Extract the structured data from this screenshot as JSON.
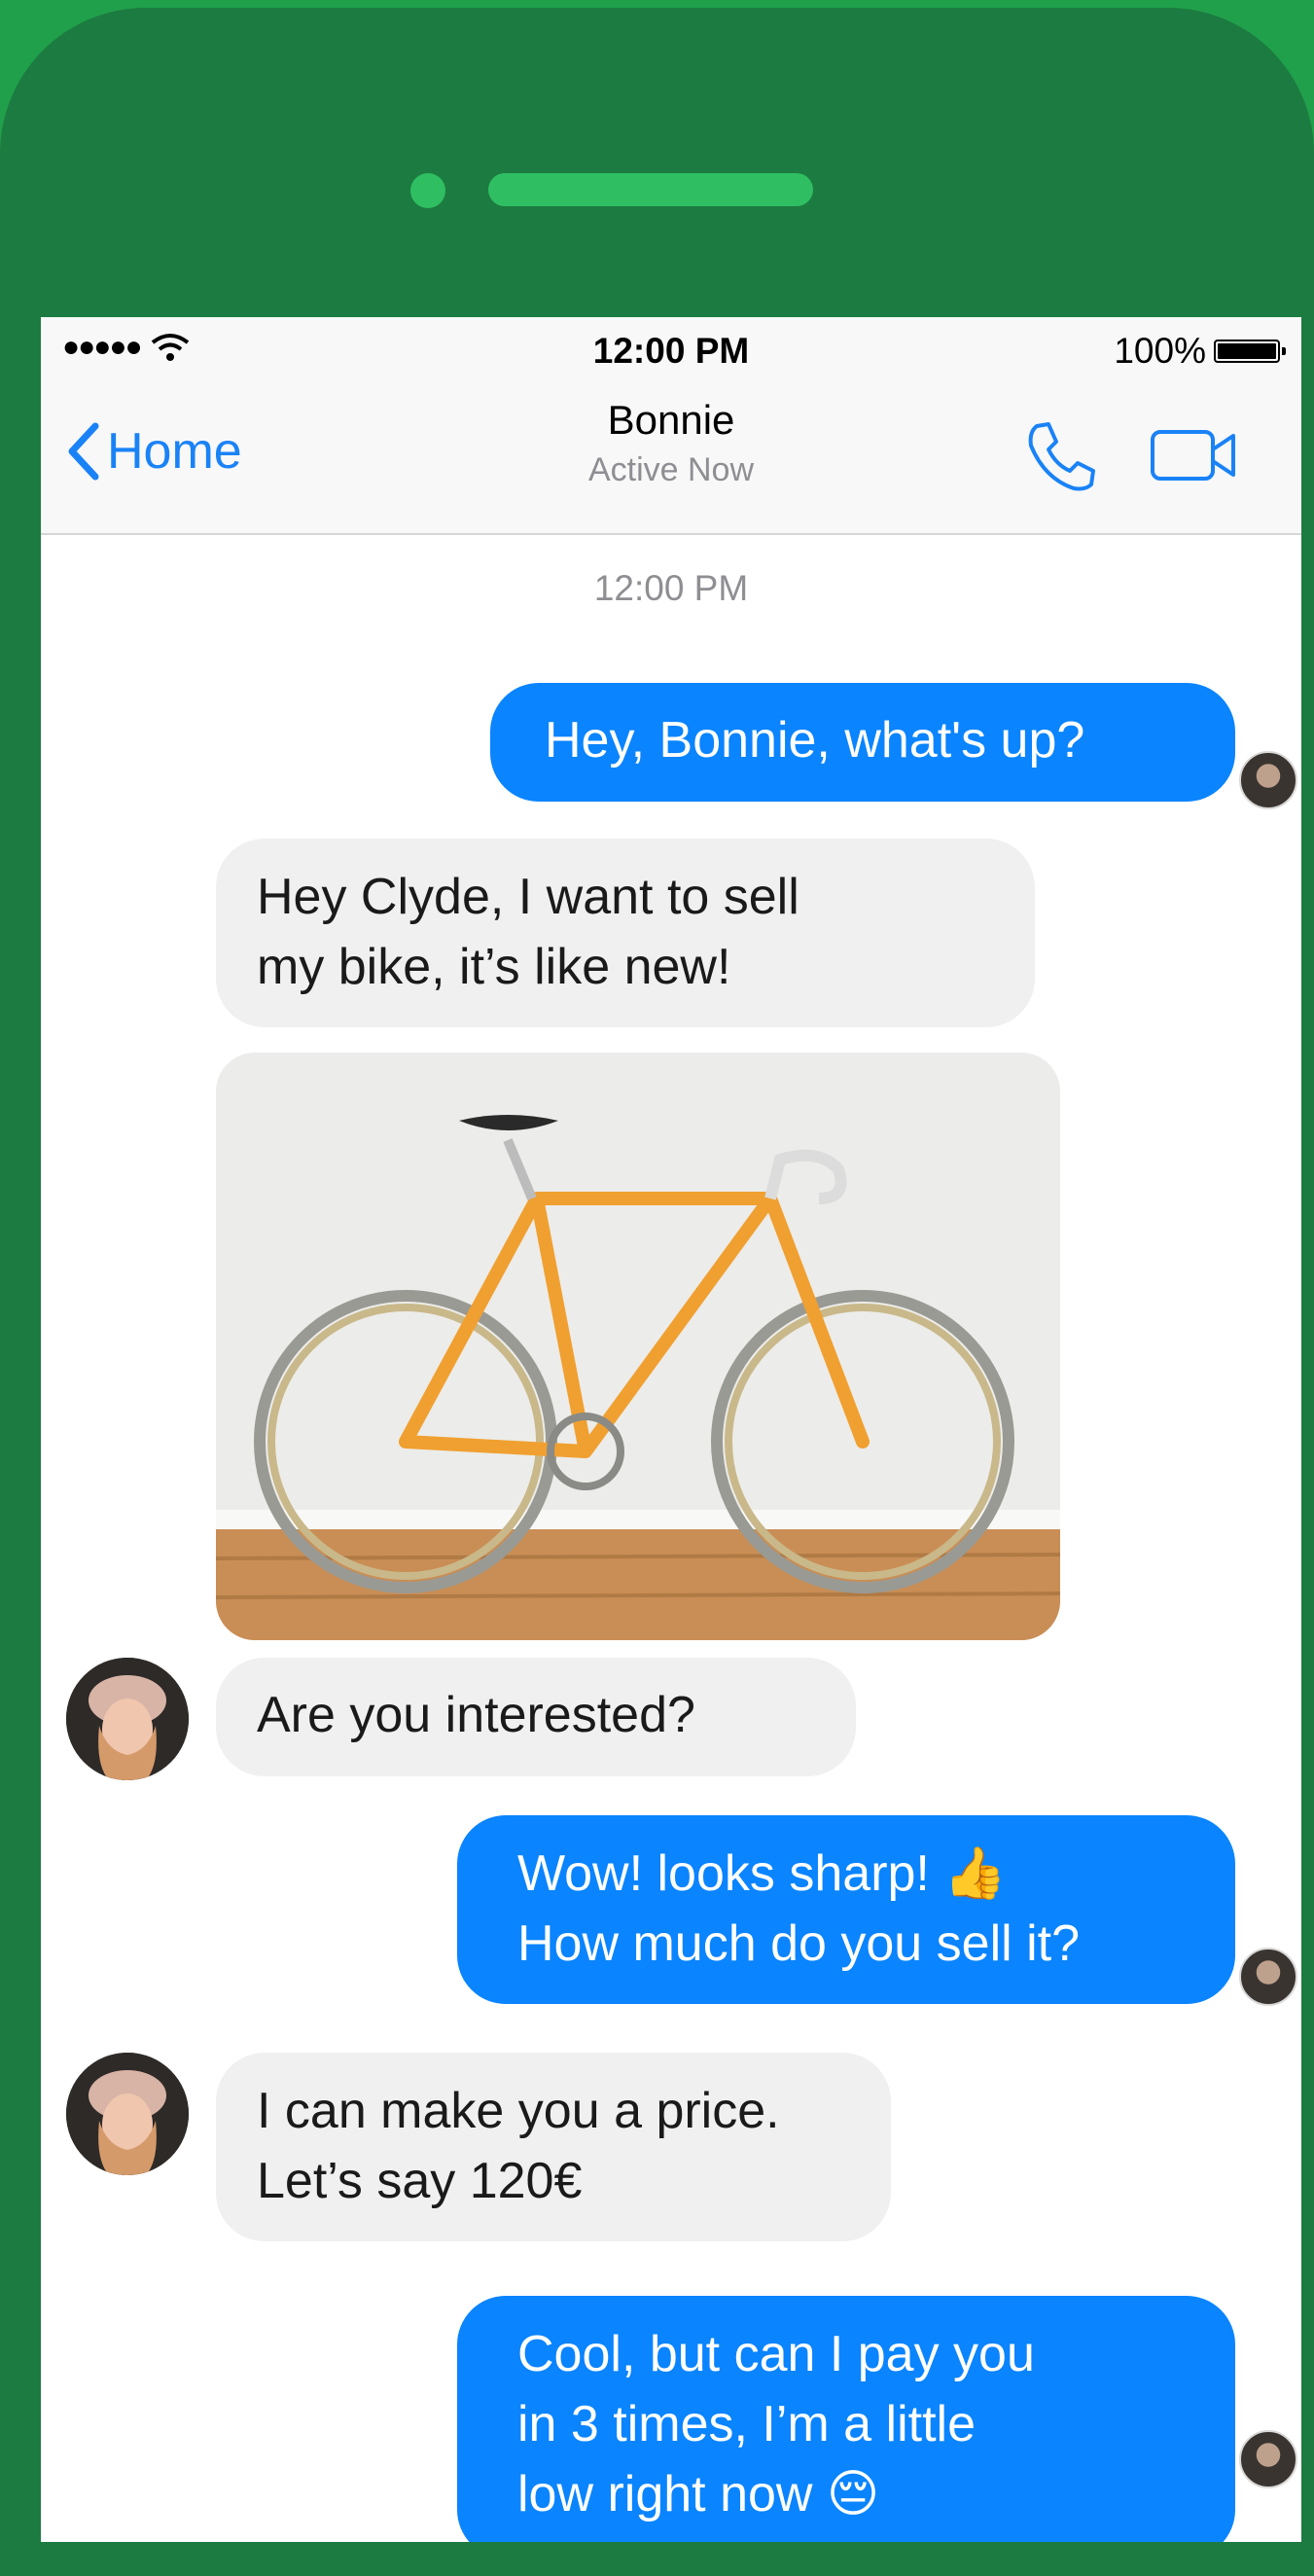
{
  "status_bar": {
    "carrier_dots": "●●●●●",
    "time": "12:00 PM",
    "battery": "100%"
  },
  "nav": {
    "back_label": "Home",
    "contact_name": "Bonnie",
    "contact_status": "Active Now"
  },
  "conversation": {
    "timestamp": "12:00 PM",
    "messages": [
      {
        "from": "me",
        "text": "Hey, Bonnie, what's up?"
      },
      {
        "from": "them",
        "line1": "Hey Clyde, I want to sell",
        "line2": "my bike, it’s like new!"
      },
      {
        "from": "them",
        "image": "bike-photo"
      },
      {
        "from": "them",
        "text": "Are you interested?"
      },
      {
        "from": "me",
        "line1": "Wow! looks sharp! 👍",
        "line2": "How much do you sell it?"
      },
      {
        "from": "them",
        "line1": "I can make you a price.",
        "line2": "Let’s say 120€"
      },
      {
        "from": "me",
        "line1": "Cool, but can I pay you",
        "line2": "in 3 times, I’m a little",
        "line3": "low right now 😔"
      }
    ]
  },
  "colors": {
    "outgoing_bubble": "#0a84ff",
    "incoming_bubble": "#f0f0f0",
    "accent": "#1a82f7",
    "device": "#1c7b40",
    "background": "#21a04c"
  }
}
